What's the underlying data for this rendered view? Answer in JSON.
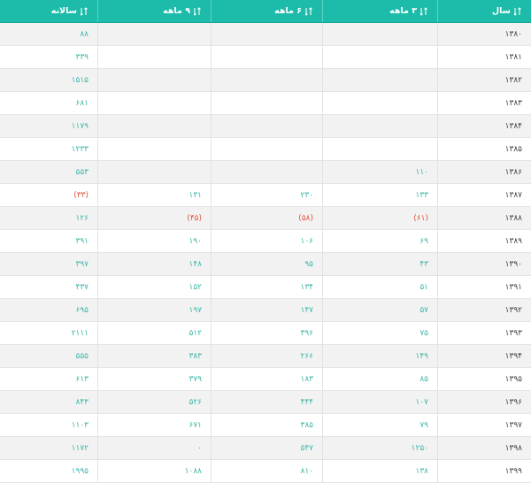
{
  "header": {
    "year": "سال",
    "q3": "۳ ماهه",
    "q6": "۶ ماهه",
    "q9": "۹ ماهه",
    "annual": "سالانه"
  },
  "colors": {
    "header_bg": "#1dbcaa",
    "value": "#3eb7a8",
    "negative": "#e0553f",
    "year_text": "#444444"
  },
  "rows": [
    {
      "year": "۱۳۸۰",
      "q3": "",
      "q6": "",
      "q9": "",
      "annual": "۸۸"
    },
    {
      "year": "۱۳۸۱",
      "q3": "",
      "q6": "",
      "q9": "",
      "annual": "۳۳۹"
    },
    {
      "year": "۱۳۸۲",
      "q3": "",
      "q6": "",
      "q9": "",
      "annual": "۱۵۱۵"
    },
    {
      "year": "۱۳۸۳",
      "q3": "",
      "q6": "",
      "q9": "",
      "annual": "۶۸۱"
    },
    {
      "year": "۱۳۸۴",
      "q3": "",
      "q6": "",
      "q9": "",
      "annual": "۱۱۷۹"
    },
    {
      "year": "۱۳۸۵",
      "q3": "",
      "q6": "",
      "q9": "",
      "annual": "۱۲۳۳"
    },
    {
      "year": "۱۳۸۶",
      "q3": "۱۱۰",
      "q6": "",
      "q9": "",
      "annual": "۵۵۳"
    },
    {
      "year": "۱۳۸۷",
      "q3": "۱۳۳",
      "q6": "۲۳۰",
      "q9": "۱۳۱",
      "annual": "(۳۳)"
    },
    {
      "year": "۱۳۸۸",
      "q3": "(۶۱)",
      "q6": "(۵۸)",
      "q9": "(۴۵)",
      "annual": "۱۲۶"
    },
    {
      "year": "۱۳۸۹",
      "q3": "۶۹",
      "q6": "۱۰۶",
      "q9": "۱۹۰",
      "annual": "۳۹۱"
    },
    {
      "year": "۱۳۹۰",
      "q3": "۴۳",
      "q6": "۹۵",
      "q9": "۱۴۸",
      "annual": "۳۹۷"
    },
    {
      "year": "۱۳۹۱",
      "q3": "۵۱",
      "q6": "۱۳۴",
      "q9": "۱۵۲",
      "annual": "۴۳۷"
    },
    {
      "year": "۱۳۹۲",
      "q3": "۵۷",
      "q6": "۱۴۷",
      "q9": "۱۹۷",
      "annual": "۶۹۵"
    },
    {
      "year": "۱۳۹۳",
      "q3": "۷۵",
      "q6": "۳۹۶",
      "q9": "۵۱۲",
      "annual": "۲۱۱۱"
    },
    {
      "year": "۱۳۹۴",
      "q3": "۱۴۹",
      "q6": "۲۶۶",
      "q9": "۳۸۳",
      "annual": "۵۵۵"
    },
    {
      "year": "۱۳۹۵",
      "q3": "۸۵",
      "q6": "۱۸۳",
      "q9": "۳۷۹",
      "annual": "۶۱۳"
    },
    {
      "year": "۱۳۹۶",
      "q3": "۱۰۷",
      "q6": "۴۴۴",
      "q9": "۵۲۶",
      "annual": "۸۴۳"
    },
    {
      "year": "۱۳۹۷",
      "q3": "۷۹",
      "q6": "۳۸۵",
      "q9": "۶۷۱",
      "annual": "۱۱۰۳"
    },
    {
      "year": "۱۳۹۸",
      "q3": "۱۲۵۰",
      "q6": "۵۴۷",
      "q9": "۰",
      "annual": "۱۱۷۲"
    },
    {
      "year": "۱۳۹۹",
      "q3": "۱۳۸",
      "q6": "۸۱۰",
      "q9": "۱۰۸۸",
      "annual": "۱۹۹۵"
    }
  ]
}
